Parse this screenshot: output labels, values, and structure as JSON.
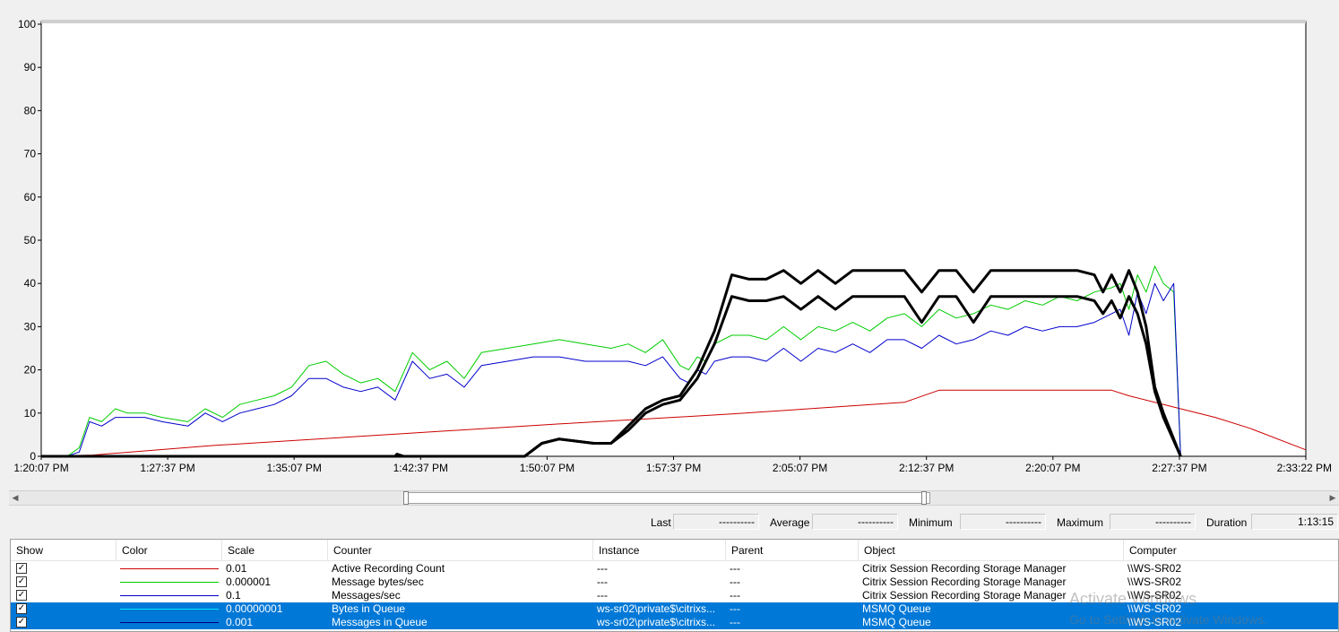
{
  "chart_data": {
    "type": "line",
    "ylim": [
      0,
      100
    ],
    "y_ticks": [
      "100",
      "90",
      "80",
      "70",
      "60",
      "50",
      "40",
      "30",
      "20",
      "10",
      "0"
    ],
    "x_ticks": [
      "1:20:07 PM",
      "1:27:37 PM",
      "1:35:07 PM",
      "1:42:37 PM",
      "1:50:07 PM",
      "1:57:37 PM",
      "2:05:07 PM",
      "2:12:37 PM",
      "2:20:07 PM",
      "2:27:37 PM",
      "2:33:22 PM"
    ],
    "x_range_minutes": [
      0,
      73.25
    ],
    "grid": false,
    "series": [
      {
        "name": "Active Recording Count",
        "color": "#cc0000",
        "x": [
          0,
          3,
          10,
          20,
          30,
          40,
          50,
          52,
          62,
          63,
          66,
          68,
          70,
          73.25
        ],
        "y": [
          0,
          0.3,
          2.5,
          5,
          7.5,
          9.8,
          12.5,
          15.3,
          15.3,
          14,
          11,
          9,
          6.5,
          1.5
        ]
      },
      {
        "name": "Message bytes/sec",
        "color": "#00cc00",
        "x": [
          0,
          1.5,
          2.2,
          2.8,
          3.5,
          4.3,
          5,
          6,
          7,
          8.5,
          9.5,
          10.5,
          11.5,
          12.5,
          13.5,
          14.5,
          15.5,
          16.5,
          17.5,
          18.5,
          19.5,
          20.5,
          21.5,
          22.5,
          23.5,
          24.5,
          25.5,
          27,
          28.5,
          30,
          31.5,
          33,
          34,
          35,
          36,
          37,
          37.5,
          38,
          38.5,
          39,
          40,
          41,
          42,
          43,
          44,
          45,
          46,
          47,
          48,
          49,
          50,
          51,
          52,
          53,
          54,
          55,
          56,
          57,
          58,
          59,
          60,
          61,
          62,
          62.5,
          63,
          63.5,
          64,
          64.5,
          65,
          65.6,
          66
        ],
        "y": [
          0,
          0,
          2,
          9,
          8,
          11,
          10,
          10,
          9,
          8,
          11,
          9,
          12,
          13,
          14,
          16,
          21,
          22,
          19,
          17,
          18,
          15,
          24,
          20,
          22,
          18,
          24,
          25,
          26,
          27,
          26,
          25,
          26,
          24,
          27,
          21,
          20,
          23,
          22,
          26,
          28,
          28,
          27,
          30,
          27,
          30,
          29,
          31,
          29,
          32,
          33,
          30,
          34,
          32,
          33,
          35,
          34,
          36,
          35,
          37,
          36,
          38,
          39,
          40,
          34,
          42,
          38,
          44,
          40,
          38,
          0
        ]
      },
      {
        "name": "Messages/sec",
        "color": "#0000cc",
        "x": [
          0,
          1.5,
          2.2,
          2.8,
          3.5,
          4.3,
          5,
          6,
          7,
          8.5,
          9.5,
          10.5,
          11.5,
          12.5,
          13.5,
          14.5,
          15.5,
          16.5,
          17.5,
          18.5,
          19.5,
          20.5,
          21.5,
          22.5,
          23.5,
          24.5,
          25.5,
          27,
          28.5,
          30,
          31.5,
          33,
          34,
          35,
          36,
          37,
          37.5,
          38,
          38.5,
          39,
          40,
          41,
          42,
          43,
          44,
          45,
          46,
          47,
          48,
          49,
          50,
          51,
          52,
          53,
          54,
          55,
          56,
          57,
          58,
          59,
          60,
          61,
          62,
          62.5,
          63,
          63.5,
          64,
          64.5,
          65,
          65.6,
          66
        ],
        "y": [
          0,
          0,
          1,
          8,
          7,
          9,
          9,
          9,
          8,
          7,
          10,
          8,
          10,
          11,
          12,
          14,
          18,
          18,
          16,
          15,
          16,
          13,
          22,
          18,
          19,
          16,
          21,
          22,
          23,
          23,
          22,
          22,
          22,
          21,
          23,
          18,
          17,
          20,
          19,
          22,
          23,
          23,
          22,
          25,
          22,
          25,
          24,
          26,
          24,
          27,
          27,
          25,
          28,
          26,
          27,
          29,
          28,
          30,
          29,
          30,
          30,
          31,
          33,
          34,
          28,
          38,
          33,
          40,
          36,
          40,
          0
        ]
      },
      {
        "name": "Bytes in Queue",
        "color": "#000000",
        "x": [
          0,
          20.5,
          20.6,
          21,
          28,
          29,
          30,
          32,
          33,
          34,
          35,
          36,
          37,
          38,
          39,
          40,
          41,
          42,
          43,
          44,
          45,
          46,
          47,
          48,
          49,
          50,
          51,
          52,
          53,
          54,
          55,
          56,
          57,
          58,
          59,
          60,
          61,
          61.5,
          62,
          62.5,
          63,
          63.5,
          64,
          64.5,
          65,
          66
        ],
        "y": [
          0,
          0,
          0.5,
          0,
          0,
          3,
          4,
          3,
          3,
          6,
          10,
          12,
          13,
          18,
          26,
          37,
          36,
          36,
          37,
          34,
          37,
          34,
          37,
          37,
          37,
          37,
          31,
          37,
          37,
          31,
          37,
          37,
          37,
          37,
          37,
          37,
          36,
          33,
          36,
          32,
          37,
          33,
          26,
          15,
          9,
          0
        ]
      },
      {
        "name": "Messages in Queue",
        "color": "#000000",
        "x": [
          0,
          28,
          29,
          30,
          32,
          33,
          34,
          35,
          36,
          37,
          38,
          39,
          40,
          41,
          42,
          43,
          44,
          45,
          46,
          47,
          48,
          49,
          50,
          51,
          52,
          53,
          54,
          55,
          56,
          57,
          58,
          59,
          60,
          61,
          61.5,
          62,
          62.5,
          63,
          63.5,
          64,
          64.5,
          65,
          66
        ],
        "y": [
          0,
          0,
          3,
          4,
          3,
          3,
          7,
          11,
          13,
          14,
          20,
          29,
          42,
          41,
          41,
          43,
          40,
          43,
          40,
          43,
          43,
          43,
          43,
          38,
          43,
          43,
          38,
          43,
          43,
          43,
          43,
          43,
          43,
          42,
          38,
          42,
          38,
          43,
          38,
          30,
          16,
          10,
          0
        ]
      }
    ]
  },
  "stats": {
    "last_label": "Last",
    "last_value": "----------",
    "average_label": "Average",
    "average_value": "----------",
    "minimum_label": "Minimum",
    "minimum_value": "----------",
    "maximum_label": "Maximum",
    "maximum_value": "----------",
    "duration_label": "Duration",
    "duration_value": "1:13:15"
  },
  "legend": {
    "headers": {
      "show": "Show",
      "color": "Color",
      "scale": "Scale",
      "counter": "Counter",
      "instance": "Instance",
      "parent": "Parent",
      "object": "Object",
      "computer": "Computer"
    },
    "rows": [
      {
        "checked": "✓",
        "color": "#cc0000",
        "scale": "0.01",
        "counter": "Active Recording Count",
        "instance": "---",
        "parent": "---",
        "object": "Citrix Session Recording Storage Manager",
        "computer": "\\\\WS-SR02"
      },
      {
        "checked": "✓",
        "color": "#00cc00",
        "scale": "0.000001",
        "counter": "Message bytes/sec",
        "instance": "---",
        "parent": "---",
        "object": "Citrix Session Recording Storage Manager",
        "computer": "\\\\WS-SR02"
      },
      {
        "checked": "✓",
        "color": "#0000cc",
        "scale": "0.1",
        "counter": "Messages/sec",
        "instance": "---",
        "parent": "---",
        "object": "Citrix Session Recording Storage Manager",
        "computer": "\\\\WS-SR02"
      },
      {
        "checked": "✓",
        "color": "#00e5ff",
        "scale": "0.00000001",
        "counter": "Bytes in Queue",
        "instance": "ws-sr02\\private$\\citrixs...",
        "parent": "---",
        "object": "MSMQ Queue",
        "computer": "\\\\WS-SR02"
      },
      {
        "checked": "✓",
        "color": "#000080",
        "scale": "0.001",
        "counter": "Messages in Queue",
        "instance": "ws-sr02\\private$\\citrixs...",
        "parent": "---",
        "object": "MSMQ Queue",
        "computer": "\\\\WS-SR02"
      }
    ]
  },
  "watermark": {
    "line1": "Activate Windows",
    "line2": "Go to Settings to activate Windows."
  }
}
